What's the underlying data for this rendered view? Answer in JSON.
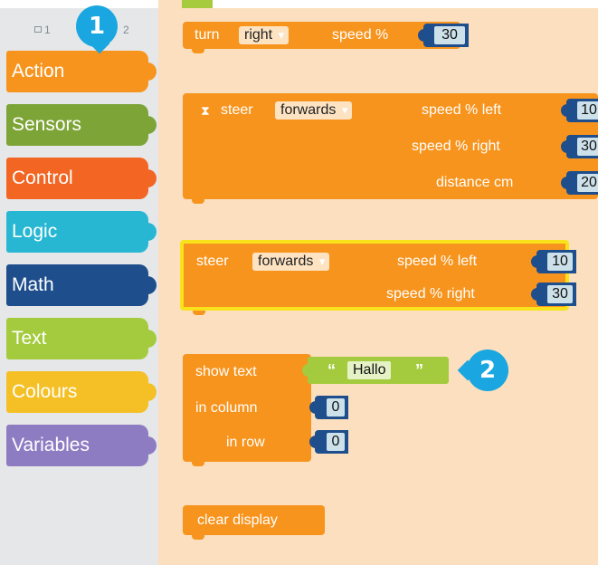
{
  "toolbox": {
    "tabs": [
      {
        "label": "1"
      },
      {
        "label": "2"
      }
    ],
    "categories": [
      {
        "label": "Action",
        "color": "#f7941d"
      },
      {
        "label": "Sensors",
        "color": "#7da436"
      },
      {
        "label": "Control",
        "color": "#f26522"
      },
      {
        "label": "Logic",
        "color": "#27b7d3"
      },
      {
        "label": "Math",
        "color": "#1f4e8c"
      },
      {
        "label": "Text",
        "color": "#a4cb3e"
      },
      {
        "label": "Colours",
        "color": "#f4c025"
      },
      {
        "label": "Variables",
        "color": "#8e7cc3"
      }
    ]
  },
  "blocks": {
    "turn": {
      "label": "turn",
      "direction": "right",
      "speed_label": "speed %",
      "speed": "30"
    },
    "steer_distance": {
      "label": "steer",
      "direction": "forwards",
      "speed_left_label": "speed %  left",
      "speed_left": "10",
      "speed_right_label": "speed %  right",
      "speed_right": "30",
      "distance_label": "distance cm",
      "distance": "20"
    },
    "steer": {
      "label": "steer",
      "direction": "forwards",
      "speed_left_label": "speed %  left",
      "speed_left": "10",
      "speed_right_label": "speed %  right",
      "speed_right": "30"
    },
    "show_text": {
      "label": "show text",
      "text": "Hallo",
      "column_label": "in column",
      "column": "0",
      "row_label": "in row",
      "row": "0"
    },
    "clear_display": {
      "label": "clear display"
    }
  },
  "callouts": {
    "one": "1",
    "two": "2"
  },
  "colors": {
    "action": "#f7941d",
    "math": "#1f4e8c",
    "text": "#a4cb3e",
    "workspace": "#fbdfbe",
    "callout": "#1aa6e0",
    "selected_outline": "#f9e21b"
  }
}
